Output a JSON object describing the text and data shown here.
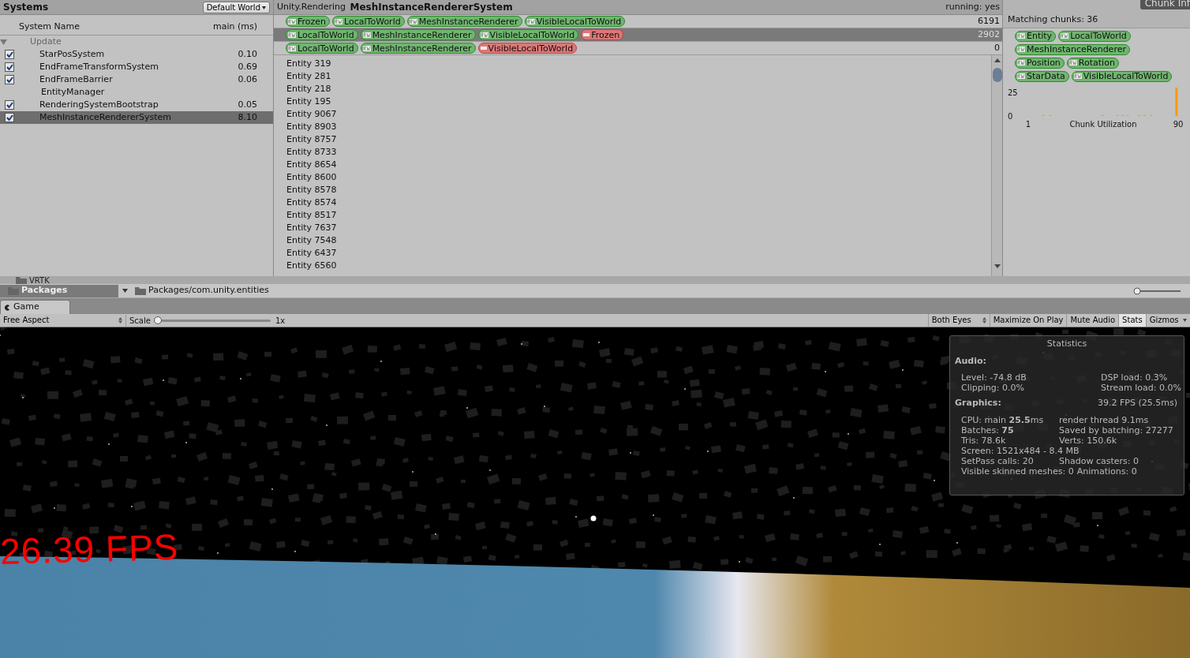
{
  "systems_panel": {
    "title": "Systems",
    "world_dropdown": "Default World",
    "columns": [
      "System Name",
      "main (ms)"
    ],
    "group": {
      "label": "Update",
      "expanded": true,
      "children": [
        {
          "kind": "toggle",
          "name": "StarPosSystem",
          "time": "0.10",
          "checked": true,
          "selected": false
        },
        {
          "kind": "toggle",
          "name": "EndFrameTransformSystem",
          "time": "0.69",
          "checked": true,
          "selected": false
        },
        {
          "kind": "toggle",
          "name": "EndFrameBarrier",
          "time": "0.06",
          "checked": true,
          "selected": false
        },
        {
          "kind": "plain",
          "name": "EntityManager",
          "selected": false
        },
        {
          "kind": "toggle",
          "name": "RenderingSystemBootstrap",
          "time": "0.05",
          "checked": true,
          "selected": false
        },
        {
          "kind": "toggle",
          "name": "MeshInstanceRendererSystem",
          "time": "8.10",
          "checked": true,
          "selected": true
        }
      ]
    }
  },
  "system_detail": {
    "namespace": "Unity.Rendering",
    "name": "MeshInstanceRendererSystem",
    "running": "running: yes",
    "queries": [
      {
        "selected": false,
        "count": "6191",
        "components": [
          {
            "kind": "required",
            "name": "Frozen"
          },
          {
            "kind": "required",
            "name": "LocalToWorld"
          },
          {
            "kind": "required",
            "name": "MeshInstanceRenderer"
          },
          {
            "kind": "required",
            "name": "VisibleLocalToWorld"
          }
        ]
      },
      {
        "selected": true,
        "count": "2902",
        "components": [
          {
            "kind": "required",
            "name": "LocalToWorld"
          },
          {
            "kind": "required",
            "name": "MeshInstanceRenderer"
          },
          {
            "kind": "required",
            "name": "VisibleLocalToWorld"
          },
          {
            "kind": "excluded",
            "name": "Frozen"
          }
        ]
      },
      {
        "selected": false,
        "count": "0",
        "components": [
          {
            "kind": "required",
            "name": "LocalToWorld"
          },
          {
            "kind": "required",
            "name": "MeshInstanceRenderer"
          },
          {
            "kind": "excluded",
            "name": "VisibleLocalToWorld"
          }
        ]
      }
    ],
    "entities": [
      "Entity 319",
      "Entity 281",
      "Entity 218",
      "Entity 195",
      "Entity 9067",
      "Entity 8903",
      "Entity 8757",
      "Entity 8733",
      "Entity 8654",
      "Entity 8600",
      "Entity 8578",
      "Entity 8574",
      "Entity 8517",
      "Entity 7637",
      "Entity 7548",
      "Entity 6437",
      "Entity 6560"
    ]
  },
  "chunk_info": {
    "tab": "Chunk Inf",
    "matching": "Matching chunks: 36",
    "components": [
      {
        "kind": "required",
        "name": "Entity"
      },
      {
        "kind": "required",
        "name": "LocalToWorld"
      },
      {
        "kind": "required",
        "name": "MeshInstanceRenderer"
      },
      {
        "kind": "required",
        "name": "Position"
      },
      {
        "kind": "required",
        "name": "Rotation"
      },
      {
        "kind": "required",
        "name": "StarData"
      },
      {
        "kind": "required",
        "name": "VisibleLocalToWorld"
      }
    ],
    "chart_data": {
      "type": "bar",
      "xlabel": "Chunk Utilization",
      "x": [
        10,
        14,
        45,
        54,
        57,
        60,
        67,
        70,
        74,
        89
      ],
      "values": [
        1,
        1,
        1,
        1,
        1,
        1,
        1,
        1,
        1,
        30
      ],
      "xlim": [
        1,
        90
      ],
      "ylim": [
        0,
        30
      ],
      "xticks": [
        1,
        90
      ],
      "yticks": [
        0,
        25
      ]
    }
  },
  "project_bar": {
    "folders": [
      {
        "name": "VRTK",
        "selected": false
      },
      {
        "name": "Packages",
        "selected": true
      }
    ],
    "path": "Packages/com.unity.entities",
    "zoom": {
      "level": 0.0
    }
  },
  "game_view": {
    "tab": "Game",
    "aspect": "Free Aspect",
    "scale_label": "Scale",
    "scale": {
      "level": 0.0,
      "reading": "1x"
    },
    "toolbar": [
      {
        "kind": "dropdown",
        "label": "Both Eyes",
        "on": false
      },
      {
        "kind": "toggle",
        "label": "Maximize On Play",
        "on": false
      },
      {
        "kind": "toggle",
        "label": "Mute Audio",
        "on": false
      },
      {
        "kind": "toggle",
        "label": "Stats",
        "on": true
      },
      {
        "kind": "menu",
        "label": "Gizmos",
        "on": false
      }
    ],
    "fps_text": "26.39 FPS",
    "statistics": {
      "title": "Statistics",
      "sections": [
        {
          "heading": "Audio:",
          "rows": [
            [
              "Level: -74.8 dB",
              "DSP load: 0.3%"
            ],
            [
              "Clipping: 0.0%",
              "Stream load: 0.0%"
            ]
          ]
        },
        {
          "heading": "Graphics:",
          "aside": "39.2 FPS (25.5ms)",
          "rows": [
            [
              "CPU: main **25.5**ms",
              "render thread 9.1ms"
            ],
            [
              "Batches: **75**",
              "Saved by batching: 27277"
            ],
            [
              "Tris: 78.6k",
              "Verts: 150.6k"
            ],
            [
              "Screen: 1521x484 - 8.4 MB"
            ],
            [
              "SetPass calls: 20",
              "Shadow casters: 0"
            ],
            [
              "Visible skinned meshes: 0",
              "Animations: 0"
            ]
          ]
        }
      ]
    }
  }
}
